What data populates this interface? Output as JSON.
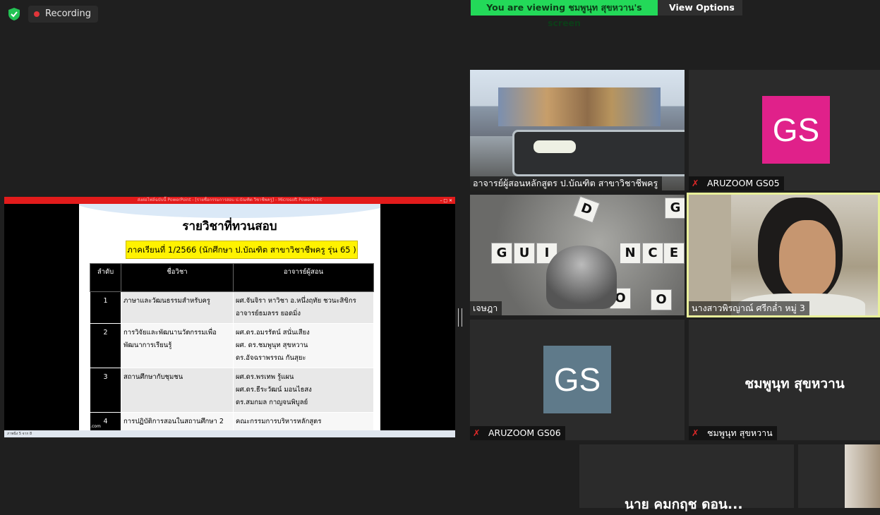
{
  "status": {
    "recording_label": "Recording"
  },
  "banner": {
    "viewing_text": "You are viewing ชมพูนุท  สุขหวาน's screen",
    "view_options_label": "View Options"
  },
  "shared_screen": {
    "window_title": "ส่งต่อไฟล์ฉบับนี้ PowerPoint - [รายชื่อกรรมการสอบ ป.บัณฑิต วิชาชีพครู] - Microsoft PowerPoint",
    "status_bar": "ภาพนิ่ง 5 จาก 8",
    "slide": {
      "title": "รายวิชาที่ทวนสอบ",
      "subtitle": "ภาคเรียนที่ 1/2566 (นักศึกษา ป.บัณฑิต สาขาวิชาชีพครู รุ่น 65 )",
      "headers": [
        "ลำดับ",
        "ชื่อวิชา",
        "อาจารย์ผู้สอน"
      ],
      "rows": [
        {
          "num": "1",
          "subject": "ภาษาและวัฒนธรรมสำหรับครู",
          "teachers": [
            "ผศ.จันจิรา หาวิชา อ.หนึ่งฤทัย ชวนะสิขิกร",
            "อาจารย์ธมลรร ยอดมิ่ง"
          ]
        },
        {
          "num": "2",
          "subject": "การวิจัยและพัฒนานวัตกรรมเพื่อพัฒนาการเรียนรู้",
          "teachers": [
            "ผศ.ดร.อมรรัตน์ สนั่นเสียง",
            "ผศ. ดร.ชมพูนุท สุขหวาน",
            "ดร.อัจฉราพรรณ  กันสุยะ"
          ]
        },
        {
          "num": "3",
          "subject": "สถานศึกษากับชุมชน",
          "teachers": [
            "ผศ.ดร.พรเทพ  รู้แผน",
            "ผศ.ดร.ธีระวัฒน์  มอนไธสง",
            "ดร.สมกมล กาญจนพิบูลย์"
          ]
        },
        {
          "num": "4",
          "subject": "การปฏิบัติการสอนในสถานศึกษา 2",
          "teachers": [
            "คณะกรรมการบริหารหลักสูตร"
          ]
        }
      ],
      "footer": "fppt.com"
    }
  },
  "participants": [
    {
      "name": "อาจารย์ผู้สอนหลักสูตร ป.บัณฑิต  สาขาวิชาชีพครู",
      "muted": false,
      "type": "video"
    },
    {
      "name": "ARUZOOM GS05",
      "muted": true,
      "type": "avatar",
      "initials": "GS",
      "color": "#e0218a"
    },
    {
      "name": "เจษฎา",
      "muted": false,
      "type": "video"
    },
    {
      "name": "นางสาวพิรญาณ์ ศรีกล่ำ หมู่ 3",
      "muted": false,
      "type": "video",
      "active_speaker": true
    },
    {
      "name": "ARUZOOM GS06",
      "muted": true,
      "type": "avatar",
      "initials": "GS",
      "color": "#5f7a8a"
    },
    {
      "name": "ชมพูนุท  สุขหวาน",
      "muted": true,
      "type": "name",
      "display": "ชมพูนุท  สุขหวาน"
    },
    {
      "name": "นาย คมกฤช ดอน...",
      "type": "name",
      "display": "นาย คมกฤช ดอน..."
    }
  ],
  "scene_text": {
    "blocks": [
      "G",
      "U",
      "I",
      "N",
      "C",
      "E",
      "D",
      "O",
      "G",
      "O"
    ]
  },
  "colors": {
    "recording_dot": "#e0353a",
    "banner_green": "#23d959",
    "active_speaker_border": "#e9f09a"
  }
}
